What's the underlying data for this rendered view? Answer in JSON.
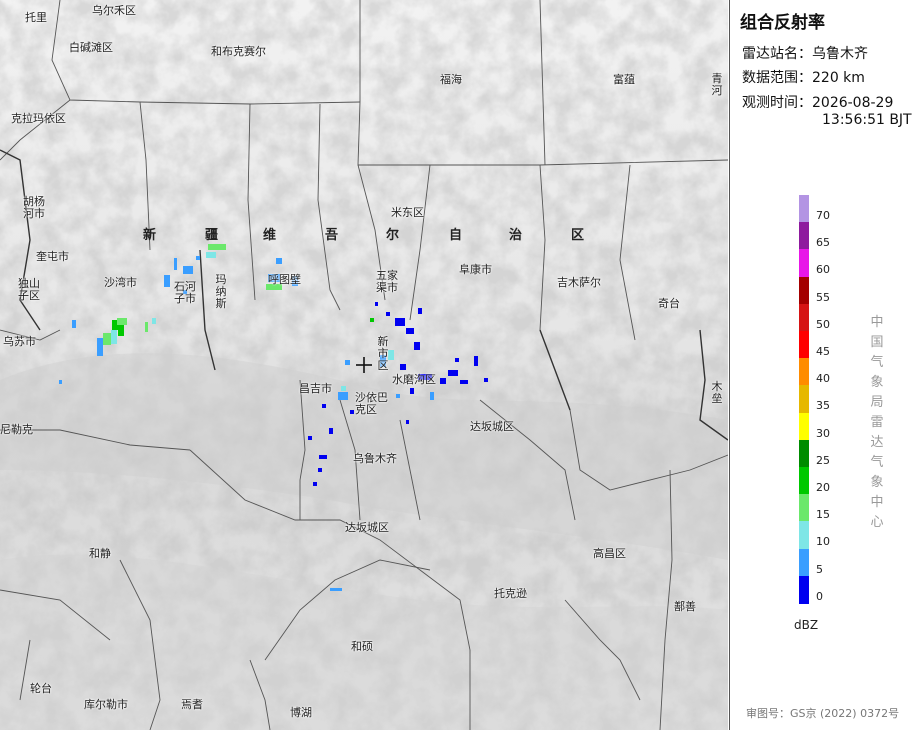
{
  "panel": {
    "title": "组合反射率",
    "station_label": "雷达站名：",
    "station_value": "乌鲁木齐",
    "range_label": "数据范围：",
    "range_value": "220 km",
    "time_label": "观测时间：",
    "time_date": "2026-08-29",
    "time_clock": "13:56:51 BJT",
    "vertical_label": "中国气象局雷达气象中心",
    "unit": "dBZ",
    "approval": "审图号：GS京 (2022) 0372号"
  },
  "legend": {
    "ticks": [
      "70",
      "65",
      "60",
      "55",
      "50",
      "45",
      "40",
      "35",
      "30",
      "25",
      "20",
      "15",
      "10",
      "5",
      "0"
    ],
    "colors": [
      "#b394e3",
      "#8e1a9e",
      "#e816e8",
      "#a40000",
      "#d61414",
      "#ff0000",
      "#ff8c00",
      "#e6b800",
      "#ffff00",
      "#008c00",
      "#00c800",
      "#6be86b",
      "#7ee6e6",
      "#3a9eff",
      "#0000f0"
    ]
  },
  "map": {
    "region_name": [
      "新",
      "疆",
      "维",
      "吾",
      "尔",
      "自",
      "治",
      "区"
    ],
    "places": [
      {
        "id": "tuoli",
        "text": "托里"
      },
      {
        "id": "wuerhe",
        "text": "乌尔禾区"
      },
      {
        "id": "baijiantan",
        "text": "白碱滩区"
      },
      {
        "id": "hebukesaier",
        "text": "和布克赛尔"
      },
      {
        "id": "fuhai",
        "text": "福海"
      },
      {
        "id": "fuyun",
        "text": "富蕴"
      },
      {
        "id": "qinghe",
        "text": "青河"
      },
      {
        "id": "kelamayi",
        "text": "克拉玛依区"
      },
      {
        "id": "huyanghe",
        "text": "胡杨河市"
      },
      {
        "id": "kuitun",
        "text": "奎屯市"
      },
      {
        "id": "dushanzi",
        "text": "独山子区"
      },
      {
        "id": "shawan",
        "text": "沙湾市"
      },
      {
        "id": "shihezi",
        "text": "石河子市"
      },
      {
        "id": "manasi",
        "text": "玛纳斯"
      },
      {
        "id": "hutubi",
        "text": "呼图壁"
      },
      {
        "id": "wujiaqu",
        "text": "五家渠市"
      },
      {
        "id": "midong",
        "text": "米东区"
      },
      {
        "id": "fukang",
        "text": "阜康市"
      },
      {
        "id": "jimusaer",
        "text": "吉木萨尔"
      },
      {
        "id": "qitai",
        "text": "奇台"
      },
      {
        "id": "mulei",
        "text": "木垒"
      },
      {
        "id": "wusu",
        "text": "乌苏市"
      },
      {
        "id": "xinshi",
        "text": "新市区"
      },
      {
        "id": "changji",
        "text": "昌吉市"
      },
      {
        "id": "shuimogou",
        "text": "水磨沟区"
      },
      {
        "id": "shayibake",
        "text": "沙依巴克区"
      },
      {
        "id": "nileike",
        "text": "尼勒克"
      },
      {
        "id": "dabancheng",
        "text": "达坂城区"
      },
      {
        "id": "wulumuqi",
        "text": "乌鲁木齐"
      },
      {
        "id": "dabancheng2",
        "text": "达坂城区"
      },
      {
        "id": "hejing",
        "text": "和静"
      },
      {
        "id": "gaochang",
        "text": "高昌区"
      },
      {
        "id": "tuokexun",
        "text": "托克逊"
      },
      {
        "id": "shanshan",
        "text": "鄯善"
      },
      {
        "id": "heshuo",
        "text": "和硕"
      },
      {
        "id": "luntai",
        "text": "轮台"
      },
      {
        "id": "kuerle",
        "text": "库尔勒市"
      },
      {
        "id": "yanqi",
        "text": "焉耆"
      },
      {
        "id": "bohu",
        "text": "博湖"
      }
    ]
  }
}
